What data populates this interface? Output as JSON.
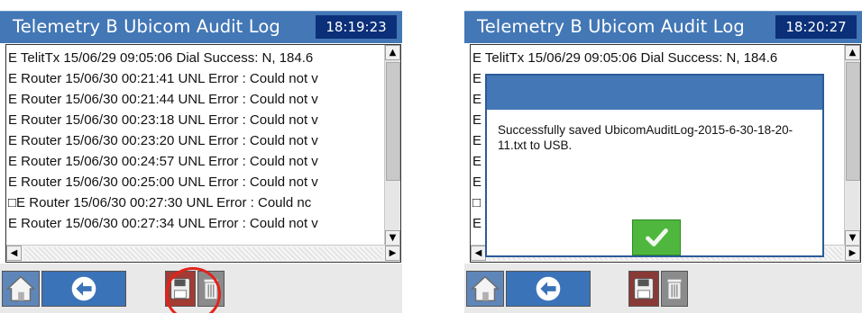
{
  "screens": [
    {
      "title": "Telemetry B Ubicom Audit Log",
      "time": "18:19:23",
      "log_lines": [
        "E TelitTx 15/06/29 09:05:06 Dial Success: N, 184.6",
        "E Router 15/06/30 00:21:41 UNL Error : Could not v",
        "E Router 15/06/30 00:21:44 UNL Error : Could not v",
        "E Router 15/06/30 00:23:18 UNL Error : Could not v",
        "E Router 15/06/30 00:23:20 UNL Error : Could not v",
        "E Router 15/06/30 00:24:57 UNL Error : Could not v",
        "E Router 15/06/30 00:25:00 UNL Error : Could not v",
        "□E Router 15/06/30 00:27:30 UNL Error : Could nc",
        "E Router 15/06/30 00:27:34 UNL Error : Could not v"
      ]
    },
    {
      "title": "Telemetry B Ubicom Audit Log",
      "time": "18:20:27",
      "log_lines": [
        "E TelitTx 15/06/29 09:05:06 Dial Success: N, 184.6",
        "E I",
        "E I",
        "E I",
        "E I",
        "E I",
        "E I",
        "□",
        "E I"
      ],
      "dialog": {
        "message": "Successfully saved UbicomAuditLog-2015-6-30-18-20-11.txt to USB."
      }
    }
  ],
  "icons": {
    "home": "home-icon",
    "back": "back-arrow-icon",
    "save": "floppy-disk-icon",
    "delete": "trash-icon",
    "ok": "checkmark-icon"
  },
  "colors": {
    "titlebar": "#4377b5",
    "clock_bg": "#0b2f78",
    "save_button": "#a23b33",
    "ok_button": "#4fb73e",
    "highlight_ring": "#e2231a"
  }
}
